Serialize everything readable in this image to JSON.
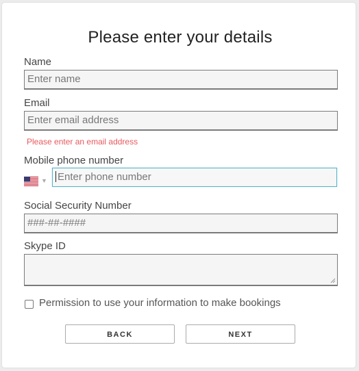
{
  "form": {
    "title": "Please enter your details",
    "name": {
      "label": "Name",
      "placeholder": "Enter name"
    },
    "email": {
      "label": "Email",
      "placeholder": "Enter email address",
      "error": "Please enter an email address"
    },
    "phone": {
      "label": "Mobile phone number",
      "placeholder": "Enter phone number",
      "country_flag": "us-flag-icon"
    },
    "ssn": {
      "label": "Social Security Number",
      "placeholder": "###-##-####"
    },
    "skype": {
      "label": "Skype ID",
      "value": ""
    },
    "permission": {
      "label": "Permission to use your information to make bookings",
      "checked": false
    },
    "buttons": {
      "back": "BACK",
      "next": "NEXT"
    }
  },
  "colors": {
    "error": "#e8585c",
    "focus_border": "#5ab3c9"
  }
}
